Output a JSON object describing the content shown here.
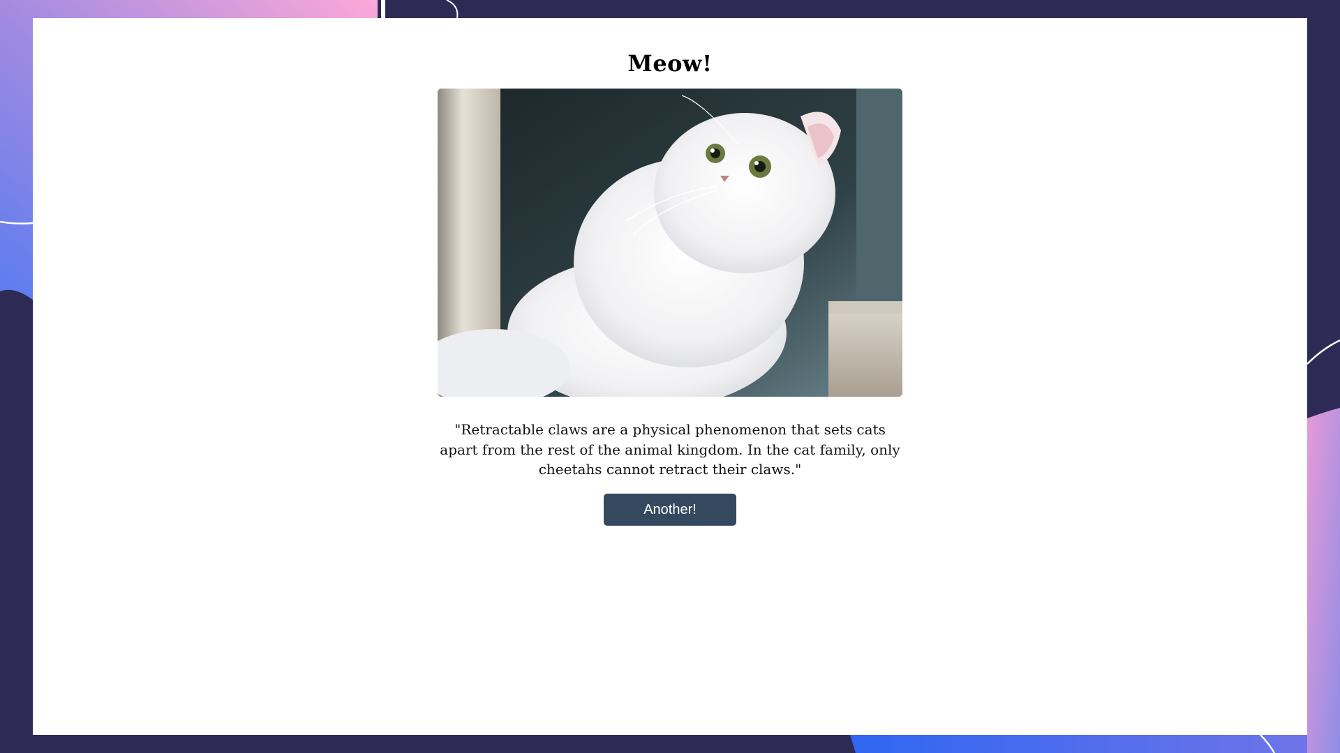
{
  "page": {
    "title": "Meow!",
    "fact": "\"Retractable claws are a physical phenomenon that sets cats apart from the rest of the animal kingdom. In the cat family, only cheetahs cannot retract their claws.\"",
    "button_label": "Another!"
  },
  "colors": {
    "background": "#2e2a56",
    "card": "#ffffff",
    "button": "#34495e",
    "button_text": "#ffffff"
  },
  "icons": {
    "photo": "white-persian-cat-photo"
  }
}
